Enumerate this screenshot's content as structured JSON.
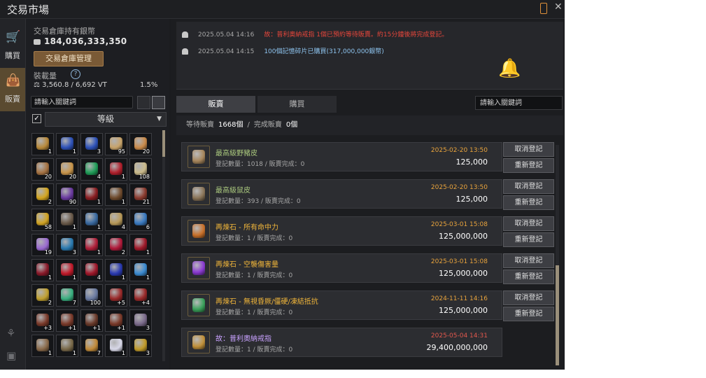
{
  "window": {
    "title": "交易市場"
  },
  "tabs": [
    {
      "label": "購買"
    },
    {
      "label": "販賣"
    }
  ],
  "inventory": {
    "silver_label": "交易倉庫持有銀幣",
    "silver": "184,036,333,350",
    "manage_button": "交易倉庫管理",
    "weight_label": "裝載量",
    "weight": "3,560.8 / 6,692 VT",
    "weight_pct": "1.5%",
    "search_placeholder": "請輸入關鍵詞",
    "grade_label": "等級",
    "items": [
      {
        "color": "#b8893a",
        "count": "1"
      },
      {
        "color": "#2e52b8",
        "count": "1"
      },
      {
        "color": "#2e52b8",
        "count": "3"
      },
      {
        "color": "#c7a36a",
        "count": "95"
      },
      {
        "color": "#c98a4a",
        "count": "20"
      },
      {
        "color": "#a57242",
        "count": "20"
      },
      {
        "color": "#c8954b",
        "count": "20"
      },
      {
        "color": "#1f9d58",
        "count": "4"
      },
      {
        "color": "#b0202c",
        "count": "1"
      },
      {
        "color": "#c9b98a",
        "count": "108"
      },
      {
        "color": "#d3a520",
        "count": "2"
      },
      {
        "color": "#6a3aa0",
        "count": "90"
      },
      {
        "color": "#8a1e22",
        "count": "1"
      },
      {
        "color": "#6e4a2c",
        "count": "1"
      },
      {
        "color": "#8a3a2e",
        "count": "21"
      },
      {
        "color": "#d0a324",
        "count": "58"
      },
      {
        "color": "#6a5a4a",
        "count": "1"
      },
      {
        "color": "#3a6aa0",
        "count": "1"
      },
      {
        "color": "#b89a5a",
        "count": "4"
      },
      {
        "color": "#3a7ac0",
        "count": "6"
      },
      {
        "color": "#9a6ad0",
        "count": "19"
      },
      {
        "color": "#2a7ab0",
        "count": "3"
      },
      {
        "color": "#b0203a",
        "count": "1"
      },
      {
        "color": "#b01a3a",
        "count": "2"
      },
      {
        "color": "#a01a2a",
        "count": "1"
      },
      {
        "color": "#8a1a2a",
        "count": "1"
      },
      {
        "color": "#c01a2a",
        "count": "1"
      },
      {
        "color": "#a0182a",
        "count": "4"
      },
      {
        "color": "#2a3ab0",
        "count": "1"
      },
      {
        "color": "#3a8ad0",
        "count": "1"
      },
      {
        "color": "#c0a030",
        "count": "2"
      },
      {
        "color": "#3ab080",
        "count": "7"
      },
      {
        "color": "#6a7aa0",
        "count": "100"
      },
      {
        "color": "#9a2a2a",
        "count": "+5"
      },
      {
        "color": "#9a2a2a",
        "count": "+4"
      },
      {
        "color": "#7a3a2a",
        "count": "+3"
      },
      {
        "color": "#7a3a2a",
        "count": "+1"
      },
      {
        "color": "#6a3a2a",
        "count": "+1"
      },
      {
        "color": "#7a3a2a",
        "count": "+1"
      },
      {
        "color": "#7a6a8a",
        "count": "3"
      },
      {
        "color": "#8a6a4a",
        "count": "1"
      },
      {
        "color": "#7a6a4a",
        "count": "1"
      },
      {
        "color": "#c08a3a",
        "count": "7"
      },
      {
        "color": "#d8d8e8",
        "count": "1"
      },
      {
        "color": "#c09a2a",
        "count": "3"
      }
    ]
  },
  "notices": [
    {
      "time": "2025.05.04 14:16",
      "text": "故：普利奧納戒指 1個已預約等待販賣。約15分鐘後將完成登記。",
      "color": "#e5463b"
    },
    {
      "time": "2025.05.04 14:15",
      "text": "100個記憶碎片已購買(317,000,000銀幣)",
      "color": "#8ec4ef"
    }
  ],
  "right": {
    "tab_sell": "販賣",
    "tab_buy": "購買",
    "search_placeholder": "請輸入關鍵詞",
    "pending_label": "等待販賣",
    "pending_count": "1668個",
    "sep": "/",
    "done_label": "完成販賣",
    "done_count": "0個"
  },
  "listings": [
    {
      "name": "最高級野豬皮",
      "name_class": "g",
      "stats": "登記數量：1018 / 販賣完成：0",
      "date": "2025-02-20 13:50",
      "date_class": "",
      "price": "125,000",
      "icon": "#a7865c",
      "buttons": [
        "取消登記",
        "重新登記"
      ]
    },
    {
      "name": "最高級鼠皮",
      "name_class": "g",
      "stats": "登記數量：393 / 販賣完成：0",
      "date": "2025-02-20 13:50",
      "date_class": "",
      "price": "125,000",
      "icon": "#8a7458",
      "buttons": [
        "取消登記",
        "重新登記"
      ]
    },
    {
      "name": "再煉石 - 所有命中力",
      "name_class": "",
      "stats": "登記數量：1 / 販賣完成：0",
      "date": "2025-03-01 15:08",
      "date_class": "",
      "price": "125,000,000",
      "icon": "#c8702a",
      "buttons": [
        "取消登記",
        "重新登記"
      ]
    },
    {
      "name": "再煉石 - 空襲傷害量",
      "name_class": "",
      "stats": "登記數量：1 / 販賣完成：0",
      "date": "2025-03-01 15:08",
      "date_class": "",
      "price": "125,000,000",
      "icon": "#8a3ad0",
      "buttons": [
        "取消登記",
        "重新登記"
      ]
    },
    {
      "name": "再煉石 - 無視昏厥/僵硬/凍結抵抗",
      "name_class": "",
      "stats": "登記數量：1 / 販賣完成：0",
      "date": "2024-11-11 14:16",
      "date_class": "",
      "price": "125,000,000",
      "icon": "#3aa05a",
      "buttons": [
        "取消登記",
        "重新登記"
      ]
    },
    {
      "name": "故：普利奧納戒指",
      "name_class": "pu",
      "stats": "登記數量：1 / 販賣完成：0",
      "date": "2025-05-04 14:31",
      "date_class": "red",
      "price": "29,400,000,000",
      "icon": "#c0903a",
      "buttons": []
    }
  ]
}
